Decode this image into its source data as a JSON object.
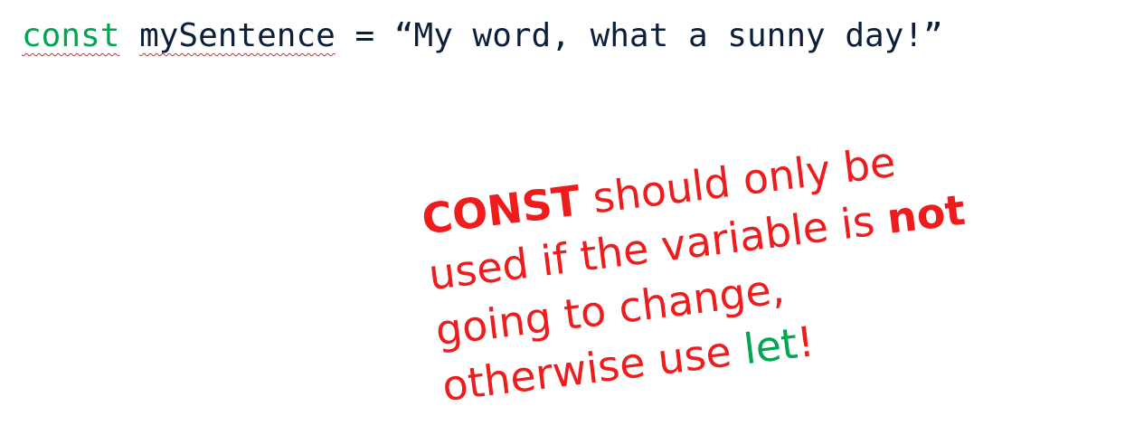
{
  "code": {
    "keyword": "const",
    "space1": " ",
    "identifier": "mySentence",
    "operator": " = ",
    "string_value": "“My word, what a sunny day!”"
  },
  "note": {
    "line1_bold": "CONST",
    "line1_rest": " should only be",
    "line2_start": "used if the variable is ",
    "line2_bold": "not",
    "line3": "going to change,",
    "line4_start": "otherwise use ",
    "line4_let": "let",
    "line4_end": "!"
  },
  "colors": {
    "keyword": "#00a651",
    "code_text": "#0b1f3a",
    "note_text": "#ee1c1c",
    "spellcheck_underline": "#d62d2d"
  }
}
